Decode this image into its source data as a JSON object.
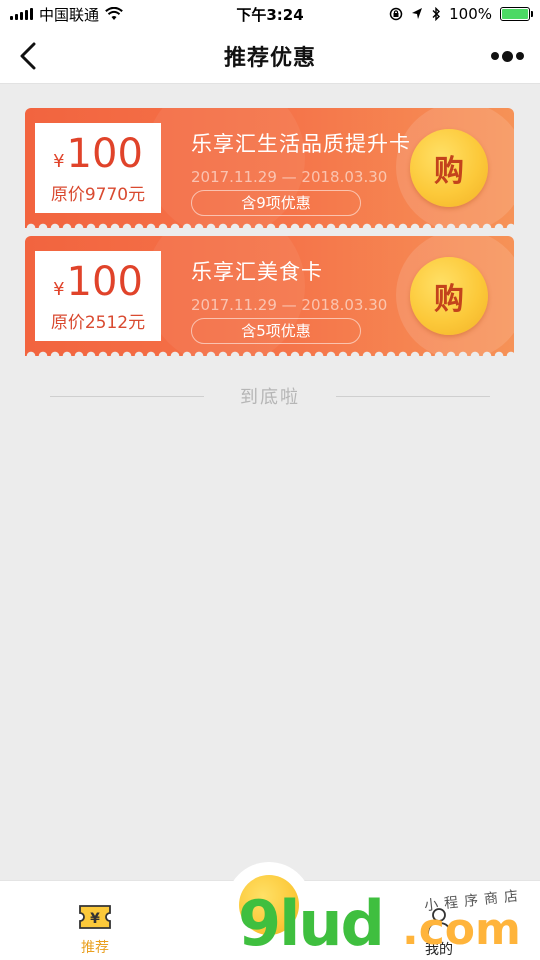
{
  "status_bar": {
    "carrier": "中国联通",
    "time": "下午3:24",
    "battery_percent": "100%",
    "battery_level": 1.0
  },
  "nav": {
    "title": "推荐优惠",
    "back_icon": "chevron-left-icon",
    "more_icon": "more-dots-icon"
  },
  "cards": [
    {
      "currency": "¥",
      "price": "100",
      "original_price": "原价9770元",
      "title": "乐享汇生活品质提升卡",
      "date_range": "2017.11.29 — 2018.03.30",
      "tag": "含9项优惠",
      "buy_label": "购"
    },
    {
      "currency": "¥",
      "price": "100",
      "original_price": "原价2512元",
      "title": "乐享汇美食卡",
      "date_range": "2017.11.29 — 2018.03.30",
      "tag": "含5项优惠",
      "buy_label": "购"
    }
  ],
  "end_text": "到底啦",
  "tabbar": {
    "recommend_label": "推荐",
    "recommend_icon": "yen-ticket-icon",
    "me_label": "我的",
    "me_icon": "person-icon"
  },
  "watermark": {
    "brand": "9lud",
    "suffix": ".com",
    "tagline": "小程序商店"
  },
  "colors": {
    "card_gradient_start": "#f2643f",
    "card_gradient_end": "#f69257",
    "buy_button": "#fcc93a",
    "accent_tab": "#e9a020"
  }
}
